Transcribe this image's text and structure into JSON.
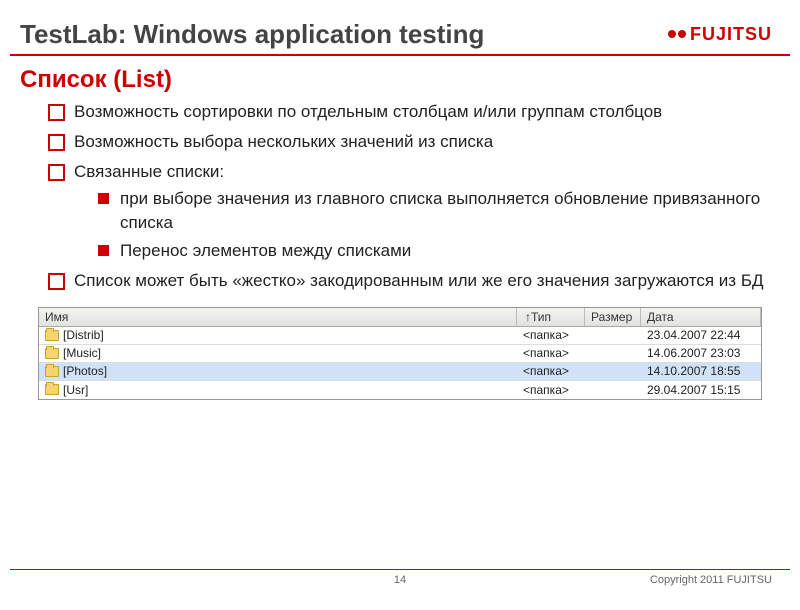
{
  "header": {
    "title": "TestLab: Windows application testing",
    "brand": "FUJITSU"
  },
  "subtitle": "Список (List)",
  "bullets": [
    {
      "text": "Возможность сортировки по отдельным столбцам и/или группам столбцов"
    },
    {
      "text": "Возможность выбора нескольких значений из списка"
    },
    {
      "text": "Связанные списки:",
      "sub": [
        "при выборе значения из главного списка выполняется обновление привязанного списка",
        "Перенос элементов между списками"
      ]
    },
    {
      "text": "Список может быть «жестко» закодированным или же его значения загружаются из БД"
    }
  ],
  "listview": {
    "columns": {
      "name": "Имя",
      "type": "↑Тип",
      "size": "Размер",
      "date": "Дата"
    },
    "rows": [
      {
        "name": "[Distrib]",
        "type": "<папка>",
        "size": "",
        "date": "23.04.2007 22:44",
        "selected": false
      },
      {
        "name": "[Music]",
        "type": "<папка>",
        "size": "",
        "date": "14.06.2007 23:03",
        "selected": false
      },
      {
        "name": "[Photos]",
        "type": "<папка>",
        "size": "",
        "date": "14.10.2007 18:55",
        "selected": true
      },
      {
        "name": "[Usr]",
        "type": "<папка>",
        "size": "",
        "date": "29.04.2007 15:15",
        "selected": false
      }
    ]
  },
  "footer": {
    "page": "14",
    "copyright": "Copyright 2011 FUJITSU"
  }
}
